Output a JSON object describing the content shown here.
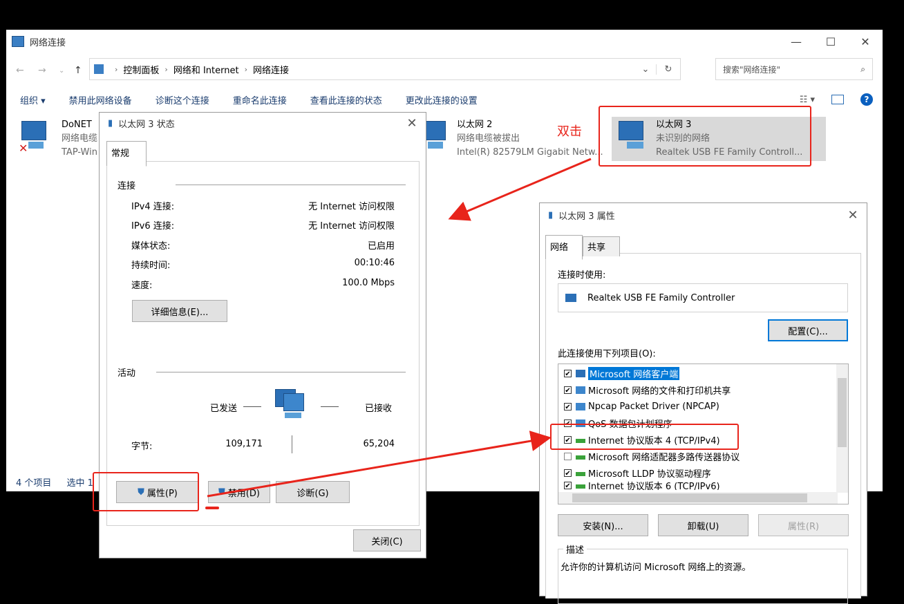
{
  "explorer": {
    "title": "网络连接",
    "breadcrumb": [
      "控制面板",
      "网络和 Internet",
      "网络连接"
    ],
    "search_placeholder": "搜索\"网络连接\"",
    "toolbar": [
      "组织 ▾",
      "禁用此网络设备",
      "诊断这个连接",
      "重命名此连接",
      "查看此连接的状态",
      "更改此连接的设置"
    ],
    "status_count": "4 个项目",
    "status_selected": "选中 1",
    "adapters": [
      {
        "name": "DoNET",
        "status": "网络电缆",
        "device": "TAP-Win"
      },
      {
        "name": "以太网 2",
        "status": "网络电缆被拔出",
        "device": "Intel(R) 82579LM Gigabit Netw..."
      },
      {
        "name": "以太网 3",
        "status": "未识别的网络",
        "device": "Realtek USB FE Family Controll..."
      }
    ]
  },
  "annotation": {
    "double_click": "双击"
  },
  "status_dialog": {
    "title": "以太网 3 状态",
    "tab": "常规",
    "section_connection": "连接",
    "rows": [
      {
        "label": "IPv4 连接:",
        "value": "无 Internet 访问权限"
      },
      {
        "label": "IPv6 连接:",
        "value": "无 Internet 访问权限"
      },
      {
        "label": "媒体状态:",
        "value": "已启用"
      },
      {
        "label": "持续时间:",
        "value": "00:10:46"
      },
      {
        "label": "速度:",
        "value": "100.0 Mbps"
      }
    ],
    "details_button": "详细信息(E)...",
    "section_activity": "活动",
    "sent_label": "已发送",
    "received_label": "已接收",
    "bytes_label": "字节:",
    "bytes_sent": "109,171",
    "bytes_received": "65,204",
    "properties_button": "属性(P)",
    "disable_button": "禁用(D)",
    "diagnose_button": "诊断(G)",
    "close_button": "关闭(C)"
  },
  "props_dialog": {
    "title": "以太网 3 属性",
    "tabs": [
      "网络",
      "共享"
    ],
    "connect_using_label": "连接时使用:",
    "adapter_name": "Realtek USB FE Family Controller",
    "configure_button": "配置(C)...",
    "items_label": "此连接使用下列项目(O):",
    "items": [
      {
        "label": "Microsoft 网络客户端",
        "checked": "✔"
      },
      {
        "label": "Microsoft 网络的文件和打印机共享",
        "checked": "✔"
      },
      {
        "label": "Npcap Packet Driver (NPCAP)",
        "checked": "✔"
      },
      {
        "label": "QoS 数据包计划程序",
        "checked": "✔"
      },
      {
        "label": "Internet 协议版本 4 (TCP/IPv4)",
        "checked": "✔"
      },
      {
        "label": "Microsoft 网络适配器多路传送器协议",
        "checked": ""
      },
      {
        "label": "Microsoft LLDP 协议驱动程序",
        "checked": "✔"
      },
      {
        "label": "Internet 协议版本 6 (TCP/IPv6)",
        "checked": "✔"
      }
    ],
    "install_button": "安装(N)...",
    "uninstall_button": "卸载(U)",
    "properties_button": "属性(R)",
    "description_label": "描述",
    "description_text": "允许你的计算机访问 Microsoft 网络上的资源。"
  },
  "colors": {
    "accent": "#0078d7",
    "annotation_red": "#e8241b"
  }
}
